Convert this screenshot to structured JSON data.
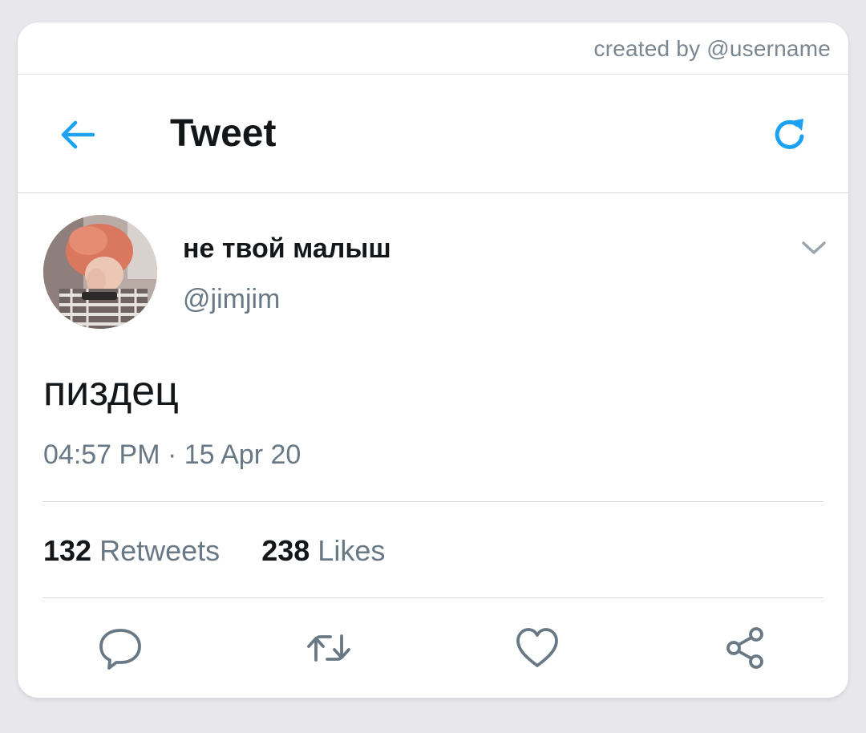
{
  "credit": "created by @username",
  "header": {
    "title": "Tweet",
    "back_icon": "arrow-left-icon",
    "refresh_icon": "refresh-icon"
  },
  "tweet": {
    "display_name": "не твой малыш",
    "handle": "@jimjim",
    "text": "пиздец",
    "timestamp": "04:57 PM · 15 Apr 20",
    "retweets_count": "132",
    "retweets_label": "Retweets",
    "likes_count": "238",
    "likes_label": "Likes"
  },
  "actions": [
    "reply-icon",
    "retweet-icon",
    "like-icon",
    "share-icon"
  ],
  "colors": {
    "accent": "#1da1f2",
    "text_primary": "#14171a",
    "text_secondary": "#697885",
    "icon_gray": "#697885",
    "divider": "#d3d7dc",
    "background": "#e8e8ec"
  }
}
